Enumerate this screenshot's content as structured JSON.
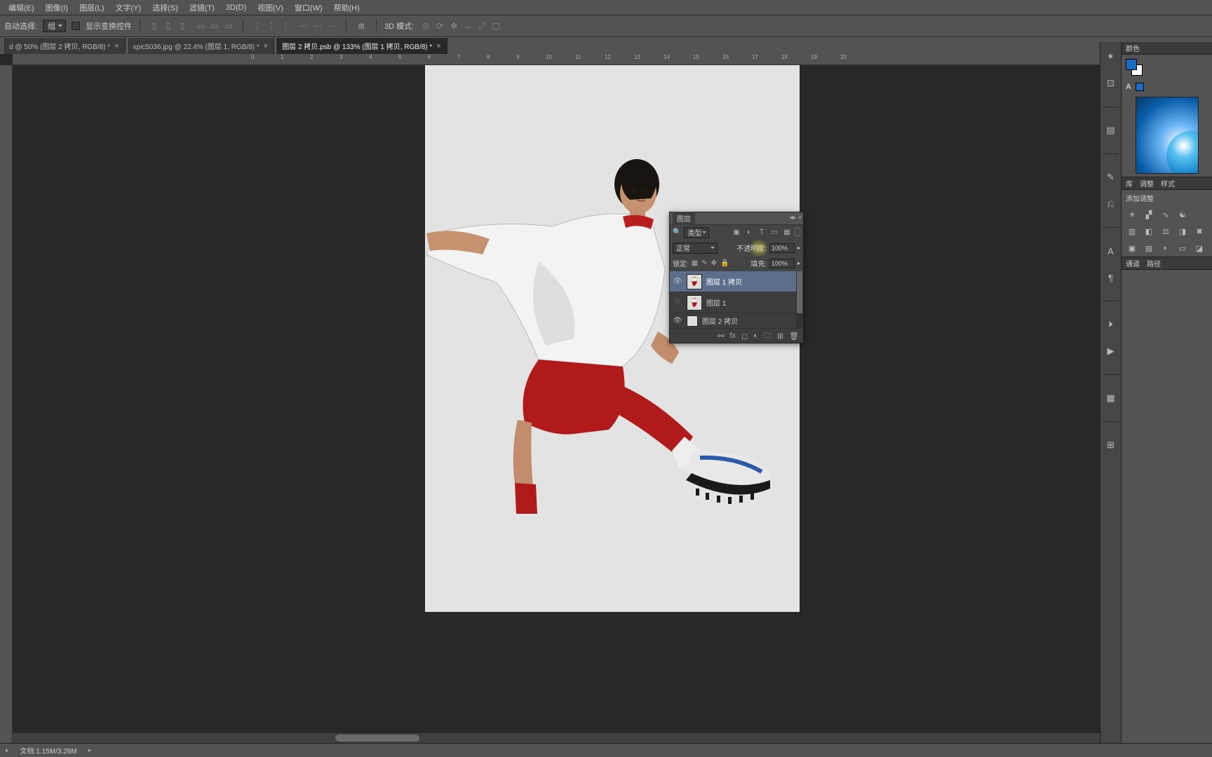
{
  "menu": {
    "items": [
      "编辑(E)",
      "图像(I)",
      "图层(L)",
      "文字(Y)",
      "选择(S)",
      "滤镜(T)",
      "3D(D)",
      "视图(V)",
      "窗口(W)",
      "帮助(H)"
    ]
  },
  "options": {
    "autoselect_label": "自动选择:",
    "autoselect_value": "组",
    "transform_controls": "显示变换控件",
    "mode3d_label": "3D 模式:"
  },
  "tabs": [
    {
      "label": "d @ 50% (图层 2 拷贝, RGB/8) *",
      "active": false
    },
    {
      "label": "xpic5036.jpg @ 22.4% (图层 1, RGB/8) *",
      "active": false
    },
    {
      "label": "图层 2 拷贝.psb @ 133% (图层 1 拷贝, RGB/8) *",
      "active": true
    }
  ],
  "ruler_ticks": [
    "0",
    "1",
    "2",
    "3",
    "4",
    "5",
    "6",
    "7",
    "8",
    "9",
    "10",
    "11",
    "12",
    "13",
    "14",
    "15",
    "16",
    "17",
    "18",
    "19",
    "20"
  ],
  "layers_panel": {
    "title": "图层",
    "filter_label": "类型",
    "blend_mode": "正常",
    "opacity_label": "不透明度:",
    "opacity_value": "100%",
    "lock_label": "锁定:",
    "fill_label": "填充:",
    "fill_value": "100%",
    "layers": [
      {
        "name": "图层 1 拷贝",
        "visible": true,
        "selected": true,
        "thumb": "figure"
      },
      {
        "name": "图层 1",
        "visible": false,
        "selected": false,
        "thumb": "figure"
      },
      {
        "name": "图层 2 拷贝",
        "visible": true,
        "selected": false,
        "partial": true,
        "thumb": "blank"
      }
    ]
  },
  "right": {
    "color_tab": "颜色",
    "lib_tab": "库",
    "adjust_tab": "调整",
    "style_tab": "样式",
    "add_adjustment": "添加调整",
    "channel_tab": "通道",
    "path_tab": "路径"
  },
  "status": {
    "doc_label": "文档:",
    "doc_value": "1.15M/3.28M"
  }
}
